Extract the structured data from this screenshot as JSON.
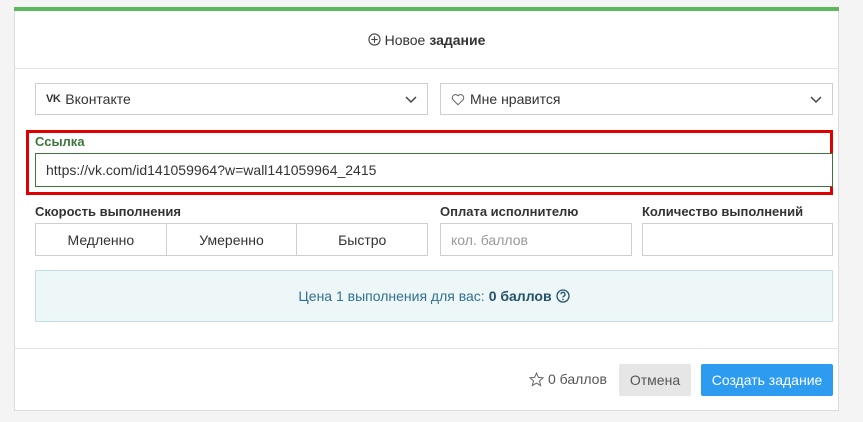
{
  "header": {
    "prefix": "Новое",
    "bold": "задание"
  },
  "network_select": {
    "value": "Вконтакте",
    "icon_text": "VK"
  },
  "action_select": {
    "value": "Мне нравится"
  },
  "link": {
    "label": "Ссылка",
    "value": "https://vk.com/id141059964?w=wall141059964_2415"
  },
  "speed": {
    "label": "Скорость выполнения",
    "options": [
      "Медленно",
      "Умеренно",
      "Быстро"
    ]
  },
  "payment": {
    "label": "Оплата исполнителю",
    "placeholder": "кол. баллов"
  },
  "count": {
    "label": "Количество выполнений",
    "placeholder": ""
  },
  "price": {
    "text": "Цена 1 выполнения для вас:",
    "value": "0 баллов"
  },
  "footer": {
    "points": "0 баллов",
    "cancel": "Отмена",
    "create": "Создать задание"
  },
  "colors": {
    "accent_green": "#5cb85c",
    "primary_blue": "#2d9bf0",
    "highlight_red": "#e00000"
  }
}
